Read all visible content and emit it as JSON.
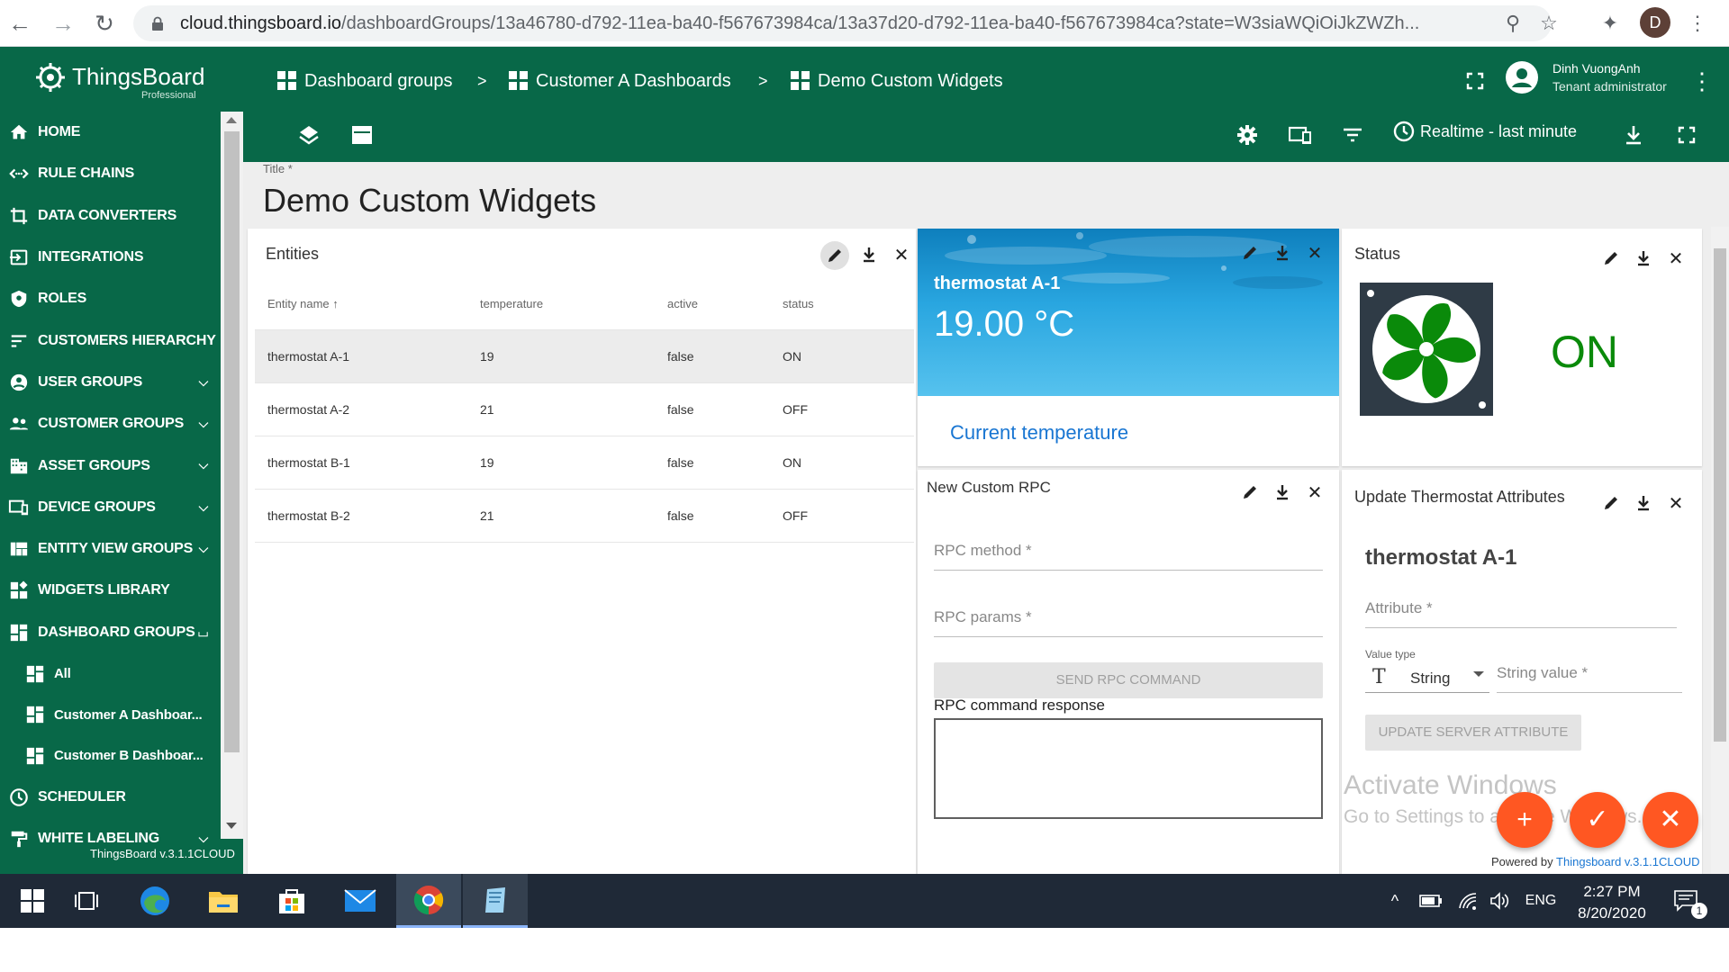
{
  "browser": {
    "url_host": "cloud.thingsboard.io",
    "url_path": "/dashboardGroups/13a46780-d792-11ea-ba40-f567673984ca/13a37d20-d792-11ea-ba40-f567673984ca?state=W3siaWQiOiJkZWZh...",
    "profile_initial": "D"
  },
  "sidebar": {
    "brand": "ThingsBoard",
    "edition": "Professional",
    "items": [
      {
        "label": "HOME"
      },
      {
        "label": "RULE CHAINS"
      },
      {
        "label": "DATA CONVERTERS"
      },
      {
        "label": "INTEGRATIONS"
      },
      {
        "label": "ROLES"
      },
      {
        "label": "CUSTOMERS HIERARCHY"
      },
      {
        "label": "USER GROUPS"
      },
      {
        "label": "CUSTOMER GROUPS"
      },
      {
        "label": "ASSET GROUPS"
      },
      {
        "label": "DEVICE GROUPS"
      },
      {
        "label": "ENTITY VIEW GROUPS"
      },
      {
        "label": "WIDGETS LIBRARY"
      },
      {
        "label": "DASHBOARD GROUPS"
      },
      {
        "label": "All"
      },
      {
        "label": "Customer A Dashboar..."
      },
      {
        "label": "Customer B Dashboar..."
      },
      {
        "label": "SCHEDULER"
      },
      {
        "label": "WHITE LABELING"
      }
    ],
    "version": "ThingsBoard v.3.1.1CLOUD"
  },
  "header": {
    "breadcrumbs": [
      "Dashboard groups",
      "Customer A Dashboards",
      "Demo Custom Widgets"
    ],
    "separator": ">",
    "user_name": "Dinh VuongAnh",
    "user_role": "Tenant administrator",
    "timewindow": "Realtime - last minute"
  },
  "dashboard": {
    "title_label": "Title *",
    "title": "Demo Custom Widgets"
  },
  "entities_widget": {
    "title": "Entities",
    "columns": [
      "Entity name",
      "temperature",
      "active",
      "status"
    ],
    "rows": [
      [
        "thermostat A-1",
        "19",
        "false",
        "ON"
      ],
      [
        "thermostat A-2",
        "21",
        "false",
        "OFF"
      ],
      [
        "thermostat B-1",
        "19",
        "false",
        "ON"
      ],
      [
        "thermostat B-2",
        "21",
        "false",
        "OFF"
      ]
    ]
  },
  "temp_widget": {
    "entity": "thermostat A-1",
    "value": "19.00 °C",
    "label": "Current temperature"
  },
  "status_widget": {
    "title": "Status",
    "state": "ON",
    "state_color": "#0a8a0a"
  },
  "rpc_widget": {
    "title": "New Custom RPC",
    "method_placeholder": "RPC method *",
    "params_placeholder": "RPC params *",
    "button": "SEND RPC COMMAND",
    "response_label": "RPC command response"
  },
  "attr_widget": {
    "title": "Update Thermostat Attributes",
    "entity": "thermostat A-1",
    "attribute_placeholder": "Attribute *",
    "value_type_label": "Value type",
    "value_type": "String",
    "value_placeholder": "String value *",
    "button": "UPDATE SERVER ATTRIBUTE",
    "powered_by": "Powered by",
    "powered_link": "Thingsboard v.3.1.1CLOUD"
  },
  "watermark": {
    "line1": "Activate Windows",
    "line2": "Go to Settings to activate Windows."
  },
  "taskbar": {
    "language": "ENG",
    "time": "2:27 PM",
    "date": "8/20/2020",
    "notification_count": "1"
  },
  "colors": {
    "primary": "#086848",
    "accent": "#ff5722",
    "link": "#1976d2"
  }
}
